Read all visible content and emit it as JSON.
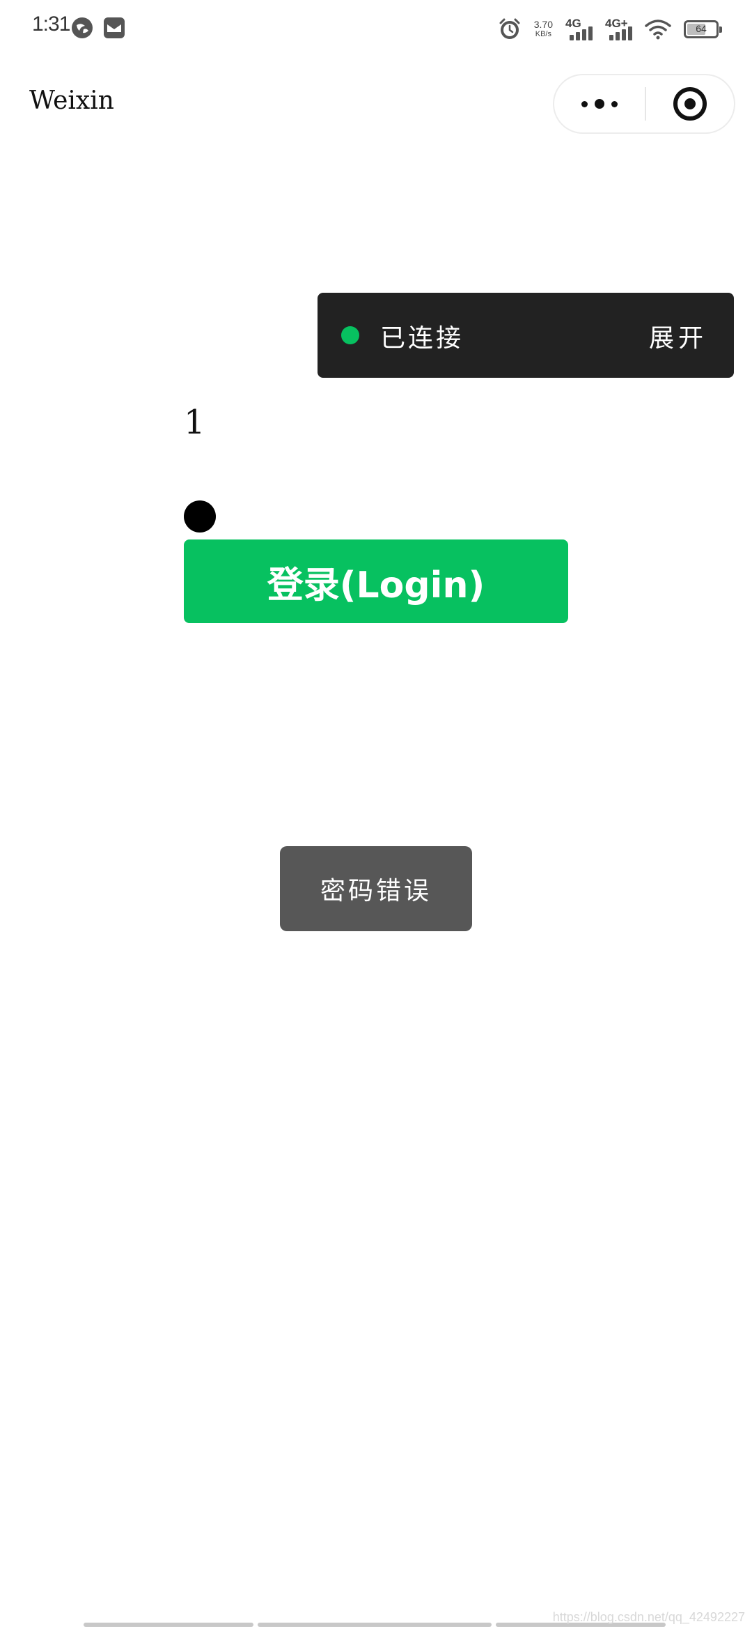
{
  "status_bar": {
    "time": "1:31",
    "net_speed_value": "3.70",
    "net_speed_unit": "KB/s",
    "signal1_label": "4G",
    "signal2_label": "4G+",
    "battery_level": "64",
    "battery_fraction": 0.64
  },
  "nav": {
    "title": "Weixin"
  },
  "connection": {
    "status": "已连接",
    "expand_label": "展开",
    "dot_color": "#07c160"
  },
  "form": {
    "account_value": "1",
    "login_button_label": "登录(Login)",
    "login_button_color": "#07c160"
  },
  "toast": {
    "message": "密码错误"
  },
  "watermark": "https://blog.csdn.net/qq_42492227"
}
